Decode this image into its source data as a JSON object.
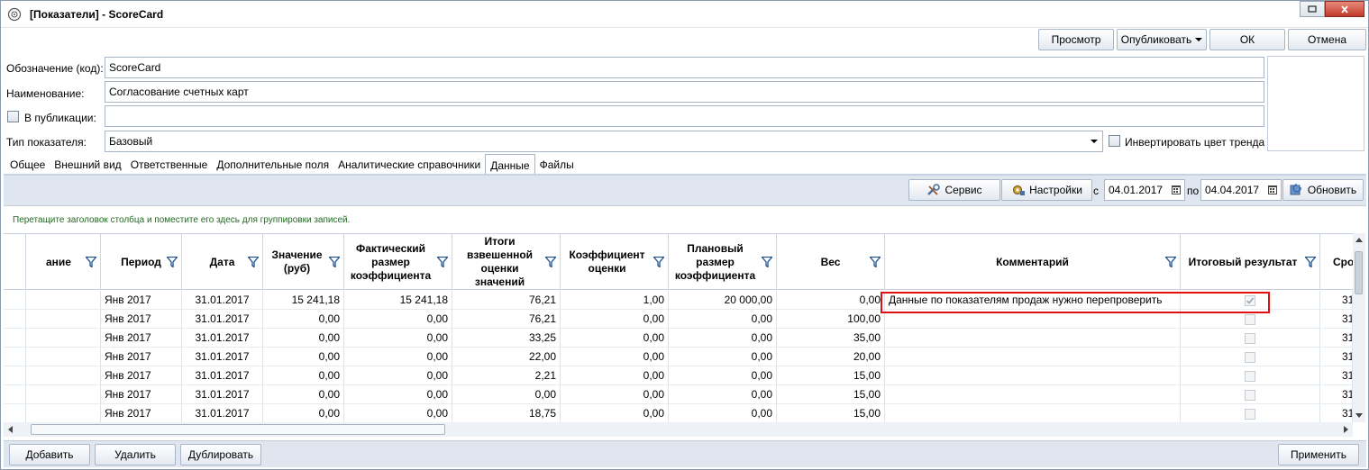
{
  "window": {
    "title": "[Показатели] - ScoreCard"
  },
  "top_buttons": {
    "preview": "Просмотр",
    "publish": "Опубликовать",
    "ok": "ОК",
    "cancel": "Отмена"
  },
  "form": {
    "code_label": "Обозначение (код):",
    "code_value": "ScoreCard",
    "name_label": "Наименование:",
    "name_value": "Согласование счетных карт",
    "publication_label": "В публикации:",
    "publication_value": "",
    "type_label": "Тип показателя:",
    "type_value": "Базовый",
    "invert_label": "Инвертировать цвет тренда"
  },
  "tabs": [
    {
      "label": "Общее"
    },
    {
      "label": "Внешний вид"
    },
    {
      "label": "Ответственные"
    },
    {
      "label": "Дополнительные поля"
    },
    {
      "label": "Аналитические справочники"
    },
    {
      "label": "Данные",
      "active": true
    },
    {
      "label": "Файлы"
    }
  ],
  "data_toolbar": {
    "service": "Сервис",
    "settings": "Настройки",
    "from_label": "с",
    "from_date": "04.01.2017",
    "to_label": "по",
    "to_date": "04.04.2017",
    "refresh": "Обновить"
  },
  "group_hint": "Перетащите заголовок столбца и поместите его здесь для группировки записей.",
  "columns": [
    {
      "label": "ание"
    },
    {
      "label": "Период"
    },
    {
      "label": "Дата"
    },
    {
      "label": "Значение (руб)"
    },
    {
      "label": "Фактический размер коэффициента"
    },
    {
      "label": "Итоги взвешенной оценки значений"
    },
    {
      "label": "Коэффициент оценки"
    },
    {
      "label": "Плановый размер коэффициента"
    },
    {
      "label": "Вес"
    },
    {
      "label": "Комментарий"
    },
    {
      "label": "Итоговый результат"
    },
    {
      "label": "Сро"
    }
  ],
  "rows": [
    {
      "period": "Янв 2017",
      "date": "31.01.2017",
      "value": "15 241,18",
      "fact": "15 241,18",
      "totals": "76,21",
      "coef": "1,00",
      "plan": "20 000,00",
      "weight": "0,00",
      "comment": "Данные по показателям продаж нужно перепроверить",
      "result": true,
      "last": "31"
    },
    {
      "period": "Янв 2017",
      "date": "31.01.2017",
      "value": "0,00",
      "fact": "0,00",
      "totals": "76,21",
      "coef": "0,00",
      "plan": "0,00",
      "weight": "100,00",
      "comment": "",
      "result": false,
      "last": "31"
    },
    {
      "period": "Янв 2017",
      "date": "31.01.2017",
      "value": "0,00",
      "fact": "0,00",
      "totals": "33,25",
      "coef": "0,00",
      "plan": "0,00",
      "weight": "35,00",
      "comment": "",
      "result": false,
      "last": "31"
    },
    {
      "period": "Янв 2017",
      "date": "31.01.2017",
      "value": "0,00",
      "fact": "0,00",
      "totals": "22,00",
      "coef": "0,00",
      "plan": "0,00",
      "weight": "20,00",
      "comment": "",
      "result": false,
      "last": "31"
    },
    {
      "period": "Янв 2017",
      "date": "31.01.2017",
      "value": "0,00",
      "fact": "0,00",
      "totals": "2,21",
      "coef": "0,00",
      "plan": "0,00",
      "weight": "15,00",
      "comment": "",
      "result": false,
      "last": "31"
    },
    {
      "period": "Янв 2017",
      "date": "31.01.2017",
      "value": "0,00",
      "fact": "0,00",
      "totals": "0,00",
      "coef": "0,00",
      "plan": "0,00",
      "weight": "15,00",
      "comment": "",
      "result": false,
      "last": "31"
    },
    {
      "period": "Янв 2017",
      "date": "31.01.2017",
      "value": "0,00",
      "fact": "0,00",
      "totals": "18,75",
      "coef": "0,00",
      "plan": "0,00",
      "weight": "15,00",
      "comment": "",
      "result": false,
      "last": "31"
    }
  ],
  "bottom_buttons": {
    "add": "Добавить",
    "delete": "Удалить",
    "duplicate": "Дублировать",
    "apply": "Применить"
  },
  "colors": {
    "highlight": "#e01010",
    "toolbar_bg": "#dfe6ef",
    "hint_text": "#1f6b1f"
  }
}
